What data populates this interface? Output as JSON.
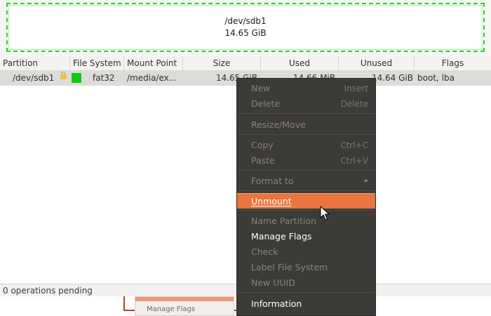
{
  "disk": {
    "device": "/dev/sdb1",
    "size": "14.65 GiB"
  },
  "table": {
    "columns": [
      "Partition",
      "File System",
      "Mount Point",
      "Size",
      "Used",
      "Unused",
      "Flags"
    ],
    "rows": [
      {
        "partition": "/dev/sdb1",
        "file_system": "fat32",
        "mount_point": "/media/ex...",
        "size": "14.65 GiB",
        "used": "14.66 MiB",
        "unused": "14.64 GiB",
        "flags": "boot, lba"
      }
    ]
  },
  "status": {
    "text": "0 operations pending"
  },
  "context_menu": {
    "items": [
      {
        "label": "New",
        "accel": "Insert",
        "enabled": false
      },
      {
        "label": "Delete",
        "accel": "Delete",
        "enabled": false
      },
      {
        "label": "Resize/Move",
        "accel": "",
        "enabled": false
      },
      {
        "label": "Copy",
        "accel": "Ctrl+C",
        "enabled": false
      },
      {
        "label": "Paste",
        "accel": "Ctrl+V",
        "enabled": false
      },
      {
        "label": "Format to",
        "accel": "",
        "enabled": false,
        "submenu": true
      },
      {
        "label": "Unmount",
        "accel": "",
        "enabled": true,
        "highlighted": true
      },
      {
        "label": "Name Partition",
        "accel": "",
        "enabled": false
      },
      {
        "label": "Manage Flags",
        "accel": "",
        "enabled": true
      },
      {
        "label": "Check",
        "accel": "",
        "enabled": false
      },
      {
        "label": "Label File System",
        "accel": "",
        "enabled": false
      },
      {
        "label": "New UUID",
        "accel": "",
        "enabled": false
      },
      {
        "label": "Information",
        "accel": "",
        "enabled": true
      }
    ]
  },
  "background_snippet": {
    "text": "Manage Flags"
  },
  "colors": {
    "fat32_swatch": "#12c812",
    "menu_highlight": "#e9743f",
    "menu_bg": "#3c3b37",
    "disk_border": "#25d025"
  }
}
